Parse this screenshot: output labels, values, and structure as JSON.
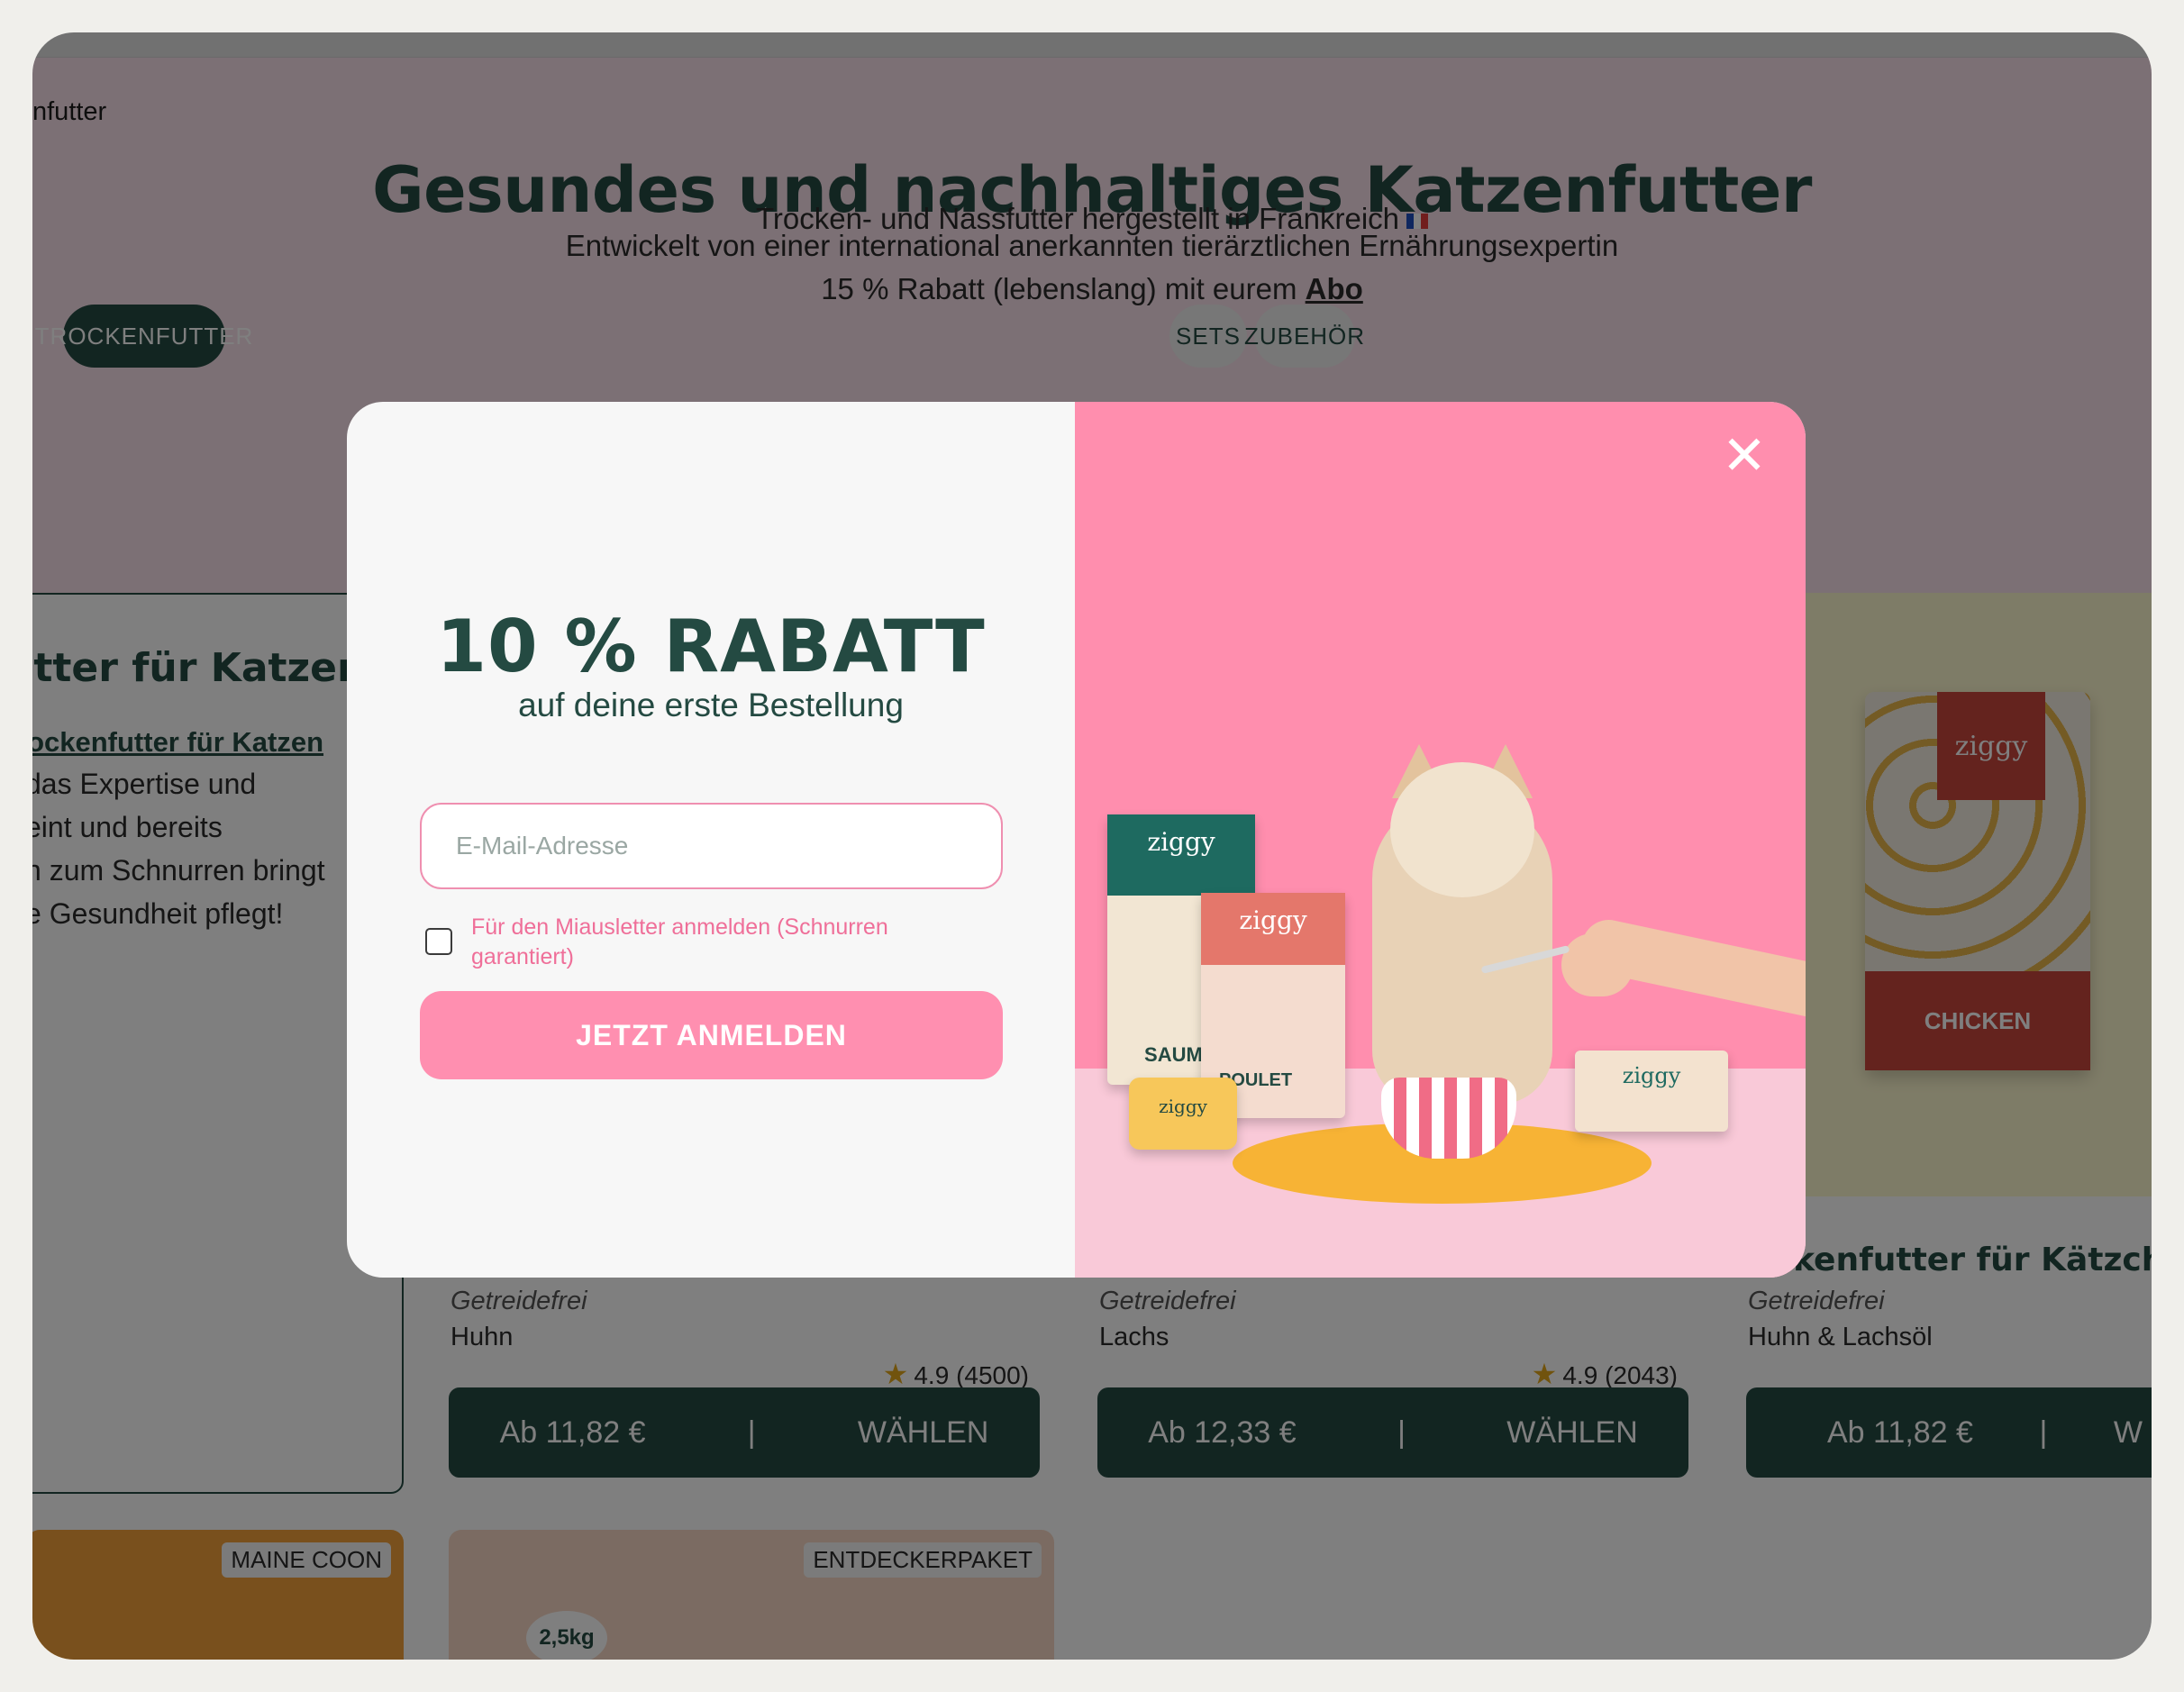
{
  "page": {
    "breadcrumb": "nfutter",
    "title": "Gesundes und nachhaltiges Katzenfutter",
    "subtitle_line1": "Trocken- und Nassfutter hergestellt in Frankreich",
    "subtitle_line2": "Entwickelt von einer international anerkannten tierärztlichen Ernährungsexpertin",
    "discount_text": "15 % Rabatt (lebenslang) mit eurem",
    "discount_link": "Abo"
  },
  "filters": {
    "active": "TROCKENFUTTER",
    "sets": "SETS",
    "zubehoer": "ZUBEHÖR"
  },
  "intro": {
    "title": "utter für Katzen",
    "link": "rockenfutter für Katzen",
    "lines": [
      "das Expertise und",
      "eint und bereits",
      "n zum Schnurren bringt",
      "e Gesundheit pflegt!"
    ]
  },
  "products": [
    {
      "attr1": "Getreidefrei",
      "attr2": "Huhn",
      "rating": "4.9",
      "reviews": "(4500)",
      "price": "Ab 11,82 €",
      "action": "WÄHLEN"
    },
    {
      "attr1": "Getreidefrei",
      "attr2": "Lachs",
      "rating": "4.9",
      "reviews": "(2043)",
      "price": "Ab 12,33 €",
      "action": "WÄHLEN"
    },
    {
      "title": "ockenfutter für Kätzche",
      "attr1": "Getreidefrei",
      "attr2": "Huhn & Lachsöl",
      "price": "Ab 11,82 €",
      "action": "W",
      "bag_brand": "ziggy",
      "bag_flavor": "CHICKEN"
    }
  ],
  "separator": "|",
  "tiles": [
    {
      "tag": "MAINE COON",
      "color": "#f2a13a"
    },
    {
      "tag": "ENTDECKERPAKET",
      "color": "#f6d7c4",
      "weight": "2,5kg"
    }
  ],
  "modal": {
    "title": "10 % RABATT",
    "subtitle": "auf deine erste Bestellung",
    "email_placeholder": "E-Mail-Adresse",
    "checkbox_label": "Für den Miausletter anmelden (Schnurren garantiert)",
    "submit_label": "JETZT ANMELDEN",
    "close_label": "✕",
    "image": {
      "pack1_brand": "ziggy",
      "pack2_brand": "ziggy",
      "pack2_flavor": "POULET",
      "pack1_flavor": "SAUMO",
      "box_brand": "ziggy",
      "can_brand": "ziggy"
    }
  },
  "colors": {
    "brand_dark": "#244a42",
    "brand_pink": "#ff8fb0",
    "hero_bg": "#f9e0ea",
    "overlay": "rgba(0,0,0,0.5)"
  }
}
